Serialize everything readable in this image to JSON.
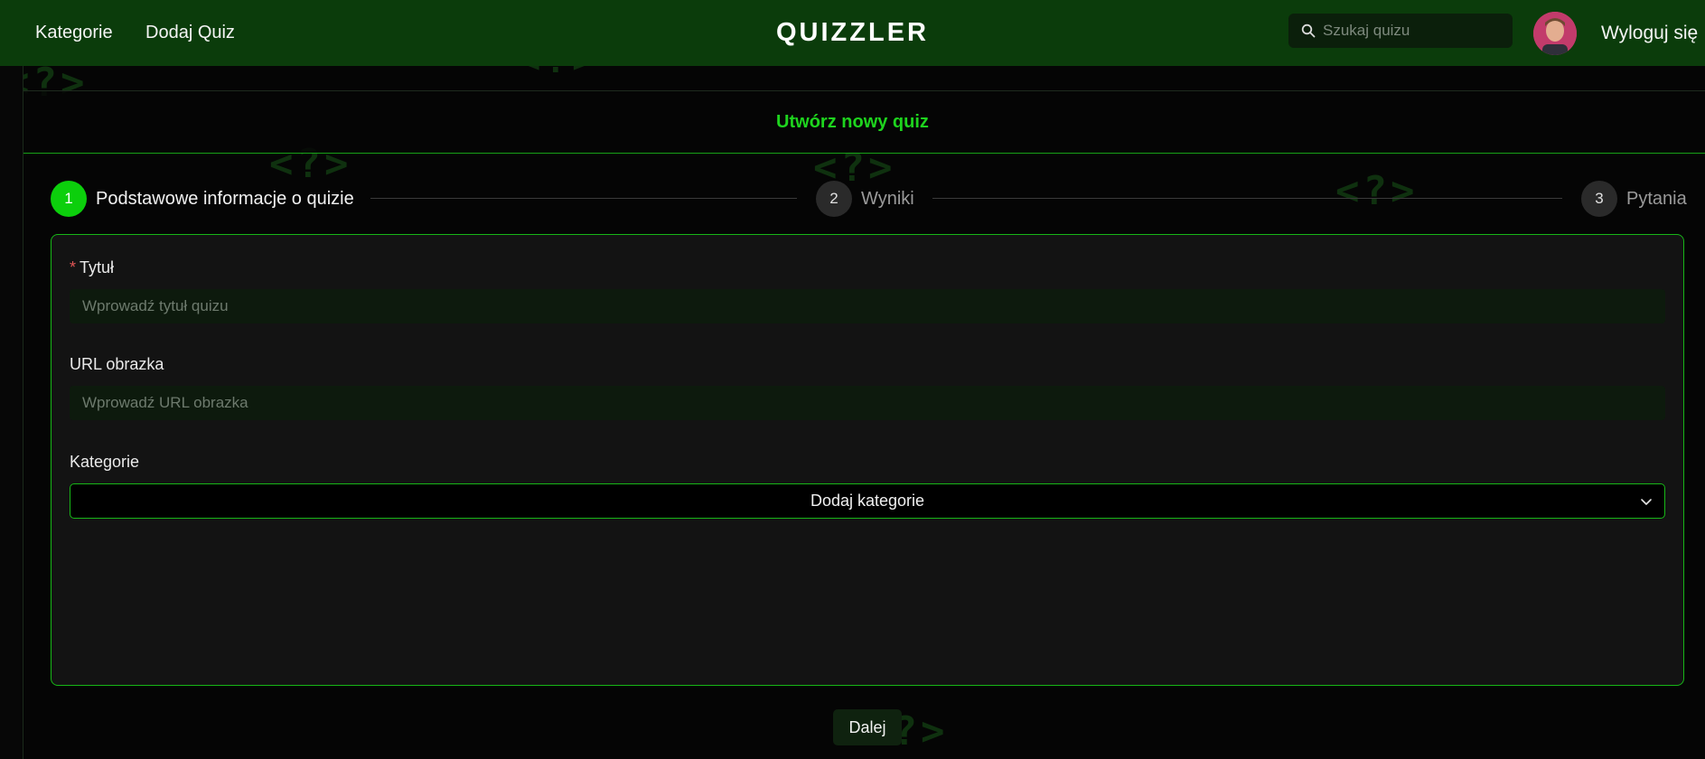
{
  "header": {
    "nav": [
      {
        "label": "Kategorie"
      },
      {
        "label": "Dodaj Quiz"
      }
    ],
    "brand": "QUIZZLER",
    "search_placeholder": "Szukaj quizu",
    "logout_label": "Wyloguj się"
  },
  "page": {
    "title": "Utwórz nowy quiz",
    "background_glyph": "<?>"
  },
  "stepper": {
    "steps": [
      {
        "number": "1",
        "label": "Podstawowe informacje o quizie",
        "state": "active"
      },
      {
        "number": "2",
        "label": "Wyniki",
        "state": "inactive"
      },
      {
        "number": "3",
        "label": "Pytania",
        "state": "inactive"
      }
    ]
  },
  "form": {
    "title_label": "Tytuł",
    "title_required_mark": "*",
    "title_placeholder": "Wprowadź tytuł quizu",
    "title_value": "",
    "image_label": "URL obrazka",
    "image_placeholder": "Wprowadź URL obrazka",
    "image_value": "",
    "category_label": "Kategorie",
    "category_select": "Dodaj kategorie"
  },
  "actions": {
    "next_label": "Dalej"
  },
  "colors": {
    "header_bg": "#0b3c0b",
    "accent": "#0ccf0c",
    "title_green": "#1ed41e",
    "required": "#e05555"
  }
}
